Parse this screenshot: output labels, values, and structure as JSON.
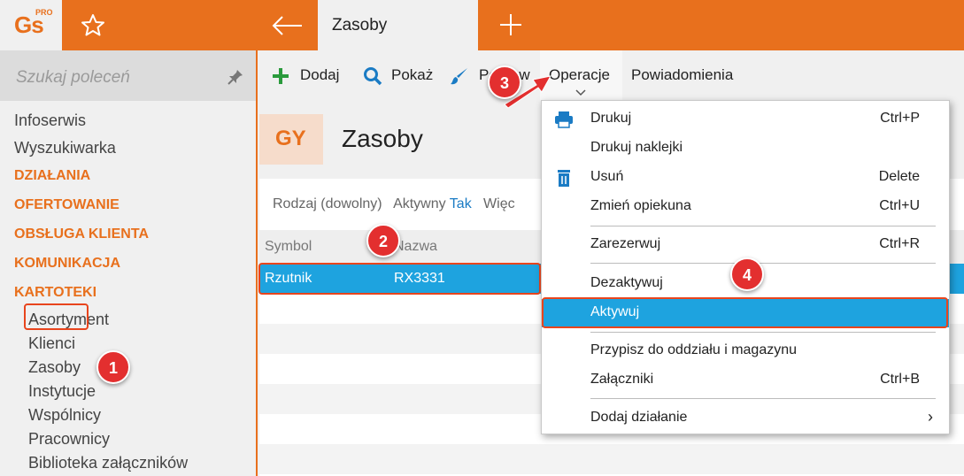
{
  "app": {
    "logo": "Gs",
    "logo_badge": "PRO",
    "active_tab": "Zasoby"
  },
  "sidebar": {
    "search_placeholder": "Szukaj poleceń",
    "items": [
      "Infoserwis",
      "Wyszukiwarka"
    ],
    "sections": [
      "DZIAŁANIA",
      "OFERTOWANIE",
      "OBSŁUGA KLIENTA",
      "KOMUNIKACJA",
      "KARTOTEKI"
    ],
    "subitems": [
      "Asortyment",
      "Klienci",
      "Zasoby",
      "Instytucje",
      "Wspólnicy",
      "Pracownicy",
      "Biblioteka załączników"
    ]
  },
  "toolbar": {
    "add": "Dodaj",
    "show": "Pokaż",
    "format": "Popraw",
    "operations": "Operacje",
    "notifications": "Powiadomienia"
  },
  "header": {
    "code": "GY",
    "title": "Zasoby"
  },
  "filter": {
    "kind": "Rodzaj (dowolny)",
    "active_label": "Aktywny",
    "active_value": "Tak",
    "more": "Więc"
  },
  "table": {
    "columns": [
      "Symbol",
      "Nazwa"
    ],
    "rows": [
      {
        "symbol": "Rzutnik",
        "name": "RX3331"
      }
    ]
  },
  "menu": {
    "items": [
      {
        "label": "Drukuj",
        "shortcut": "Ctrl+P",
        "icon": "printer-icon"
      },
      {
        "label": "Drukuj naklejki",
        "shortcut": ""
      },
      {
        "label": "Usuń",
        "shortcut": "Delete",
        "icon": "trash-icon"
      },
      {
        "label": "Zmień opiekuna",
        "shortcut": "Ctrl+U"
      },
      {
        "label": "Zarezerwuj",
        "shortcut": "Ctrl+R"
      },
      {
        "label": "Dezaktywuj",
        "shortcut": ""
      },
      {
        "label": "Aktywuj",
        "shortcut": ""
      },
      {
        "label": "Przypisz do oddziału i magazynu",
        "shortcut": ""
      },
      {
        "label": "Załączniki",
        "shortcut": "Ctrl+B"
      },
      {
        "label": "Dodaj działanie",
        "shortcut": "›"
      }
    ]
  },
  "badges": [
    "1",
    "2",
    "3",
    "4"
  ],
  "colors": {
    "accent": "#e8701d",
    "selection": "#1ea3df",
    "annotation": "#e32f2f"
  }
}
